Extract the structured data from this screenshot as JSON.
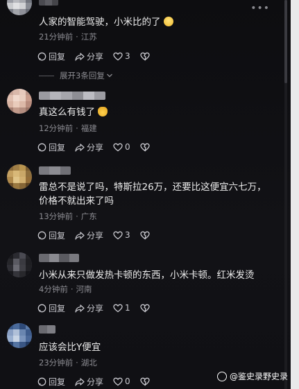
{
  "comments": [
    {
      "text": "人家的智能驾驶，小米比的了",
      "emoji": "astonished-face-emoji",
      "time": "21分钟前",
      "location": "江苏",
      "reply_label": "回复",
      "share_label": "分享",
      "like_count": "3"
    },
    {
      "text": "真这么有钱了",
      "emoji": "money-bag-emoji",
      "time": "12分钟前",
      "location": "福建",
      "reply_label": "回复",
      "share_label": "分享",
      "like_count": "0"
    },
    {
      "text": "雷总不是说了吗，特斯拉26万，还要比这便宜六七万，价格不就出来了吗",
      "time": "13分钟前",
      "location": "广东",
      "reply_label": "回复",
      "share_label": "分享",
      "like_count": "3"
    },
    {
      "text": "小米从来只做发热卡顿的东西，小米卡顿。红米发烫",
      "time": "4分钟前",
      "location": "河南",
      "reply_label": "回复",
      "share_label": "分享",
      "like_count": "1"
    },
    {
      "text": "应该会比Y便宜",
      "time": "23分钟前",
      "location": "湖北",
      "reply_label": "回复",
      "share_label": "分享",
      "like_count": "0"
    }
  ],
  "expand_replies": "展开3条回复",
  "watermark": "@鉴史录野史录",
  "colors": {
    "background": "#0b0b0d",
    "text": "#ededed",
    "meta": "#8c8c92",
    "action": "#c9c9cf"
  }
}
